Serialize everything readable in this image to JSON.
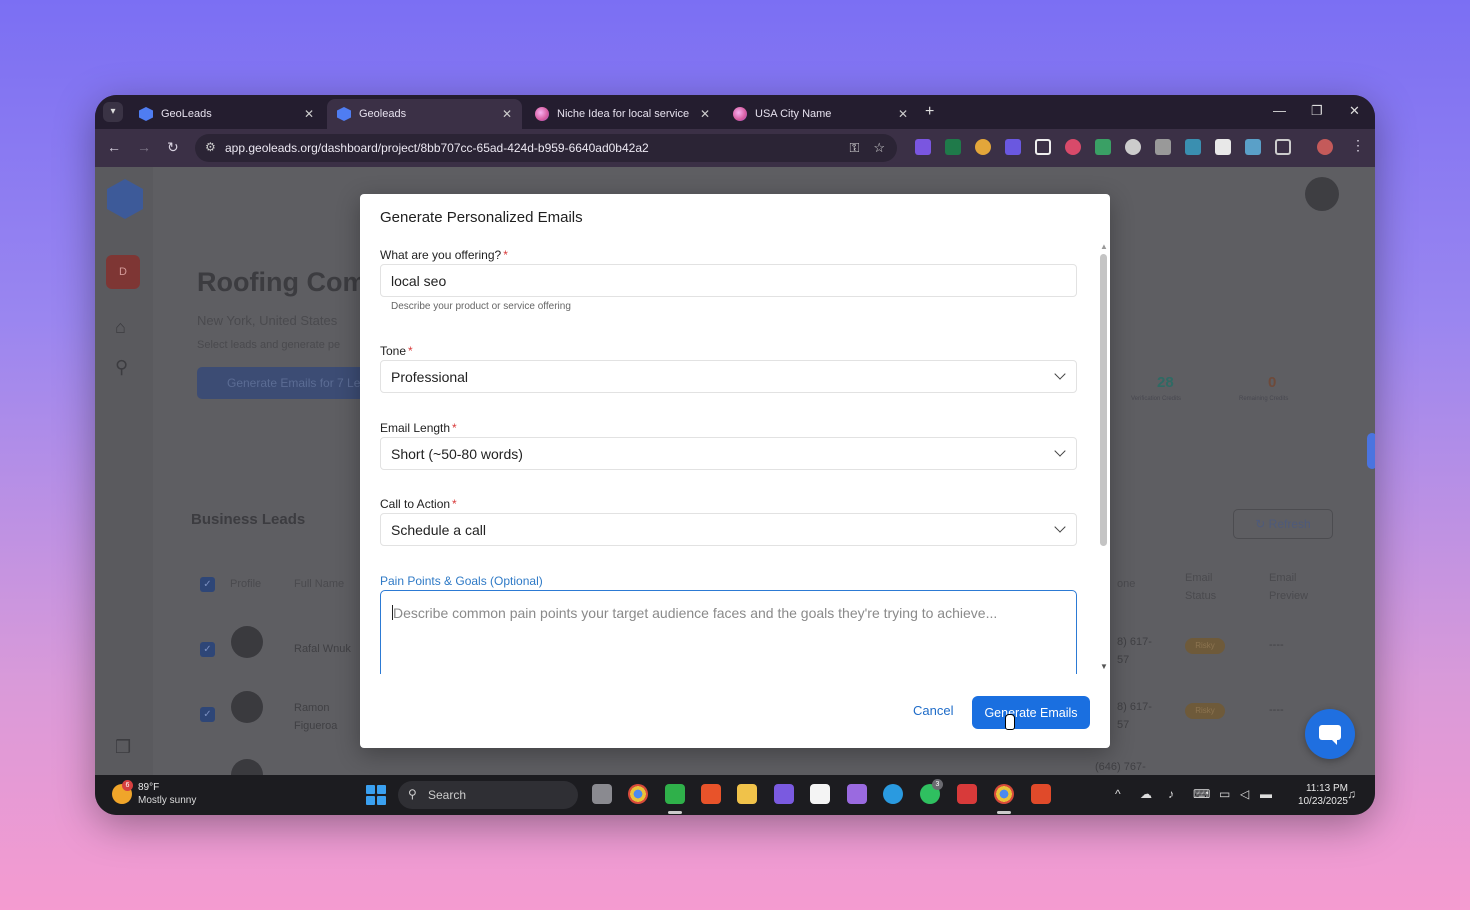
{
  "browser": {
    "tabs": [
      {
        "title": "GeoLeads",
        "active": false
      },
      {
        "title": "Geoleads",
        "active": true
      },
      {
        "title": "Niche Idea for local service",
        "active": false
      },
      {
        "title": "USA City Name",
        "active": false
      }
    ],
    "url": "app.geoleads.org/dashboard/project/8bb707cc-65ad-424d-b959-6640ad0b42a2"
  },
  "background_page": {
    "workspace_initial": "D",
    "project_title": "Roofing Com",
    "location": "New York, United States",
    "subtitle": "Select leads and generate pe",
    "generate_button": "Generate Emails for 7 Le",
    "stat_1_value": "28",
    "stat_1_label": "Verification Credits",
    "stat_2_value": "0",
    "stat_2_label": "Remaining Credits",
    "section_title": "Business Leads",
    "refresh_label": "Refresh",
    "columns": {
      "profile": "Profile",
      "full_name": "Full Name",
      "phone": "one",
      "email_status": "Email Status",
      "email_preview": "Email Preview"
    },
    "rows": [
      {
        "name": "Rafal Wnuk",
        "phone": "8) 617-57",
        "badge": "Risky",
        "preview": "----"
      },
      {
        "name": "Ramon Figueroa",
        "phone": "8) 617-57",
        "badge": "Risky",
        "preview": "----"
      },
      {
        "phone": "(646) 767-"
      }
    ]
  },
  "modal": {
    "title": "Generate Personalized Emails",
    "offering": {
      "label": "What are you offering?",
      "required_mark": "*",
      "value": "local seo",
      "helper": "Describe your product or service offering"
    },
    "tone": {
      "label": "Tone",
      "required_mark": "*",
      "value": "Professional"
    },
    "email_length": {
      "label": "Email Length",
      "required_mark": "*",
      "value": "Short (~50-80 words)"
    },
    "cta": {
      "label": "Call to Action",
      "required_mark": "*",
      "value": "Schedule a call"
    },
    "pain_points": {
      "label": "Pain Points & Goals (Optional)",
      "placeholder": "Describe common pain points your target audience faces and the goals they're trying to achieve..."
    },
    "cancel_label": "Cancel",
    "generate_label": "Generate Emails"
  },
  "taskbar": {
    "weather_badge": "6",
    "temperature": "89°F",
    "weather_desc": "Mostly sunny",
    "search_label": "Search",
    "whatsapp_badge": "3",
    "time": "11:13 PM",
    "date": "10/23/2025"
  },
  "colors": {
    "primary_button": "#1a6fe0",
    "required_star": "#d83a3a",
    "optional_label": "#2f7ac6",
    "focus_border": "#2c7ad4"
  }
}
